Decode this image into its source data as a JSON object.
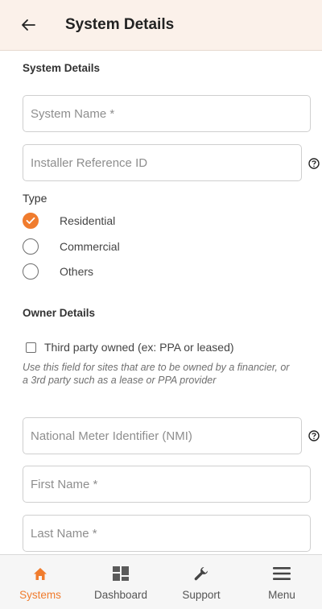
{
  "header": {
    "title": "System Details",
    "back_icon": "arrow-left-icon",
    "background": "#fbf1ea"
  },
  "system_section": {
    "title": "System Details",
    "system_name_placeholder": "System Name *",
    "installer_ref_placeholder": "Installer Reference ID",
    "type_label": "Type",
    "type_options": [
      {
        "label": "Residential",
        "selected": true
      },
      {
        "label": "Commercial",
        "selected": false
      },
      {
        "label": "Others",
        "selected": false
      }
    ]
  },
  "owner_section": {
    "title": "Owner Details",
    "third_party_label": "Third party owned (ex: PPA or leased)",
    "third_party_checked": false,
    "third_party_hint": "Use this field for sites that are to be owned by a financier, or a 3rd party such as a lease or PPA provider",
    "nmi_placeholder": "National Meter Identifier (NMI)",
    "first_name_placeholder": "First Name *",
    "last_name_placeholder": "Last Name *"
  },
  "bottom_nav": {
    "items": [
      {
        "label": "Systems",
        "icon": "home-icon",
        "active": true
      },
      {
        "label": "Dashboard",
        "icon": "dashboard-grid-icon",
        "active": false
      },
      {
        "label": "Support",
        "icon": "wrench-icon",
        "active": false
      },
      {
        "label": "Menu",
        "icon": "hamburger-menu-icon",
        "active": false
      }
    ]
  },
  "colors": {
    "accent": "#f07c2e",
    "border": "#cfcfcf",
    "nav_background": "#f6f6f6"
  }
}
